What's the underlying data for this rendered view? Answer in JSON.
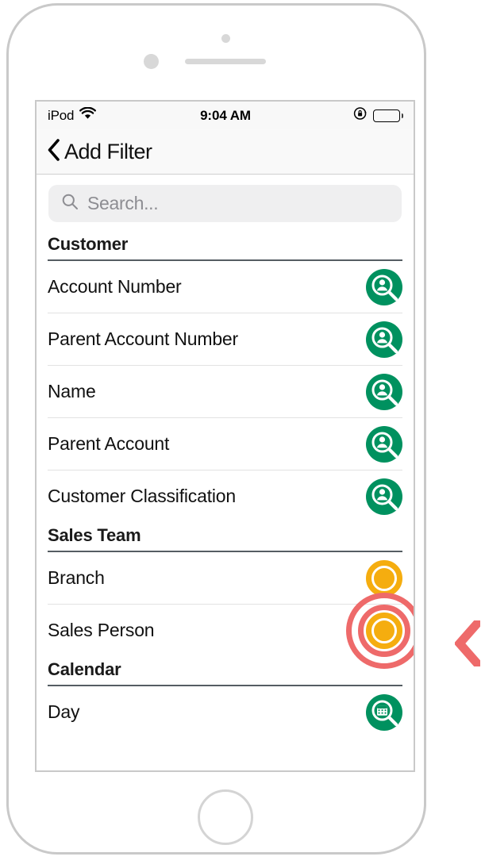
{
  "device": {
    "kind": "iphone-mockup"
  },
  "status_bar": {
    "carrier": "iPod",
    "wifi_icon": "wifi-icon",
    "time": "9:04 AM",
    "rotation_lock_icon": "rotation-lock-icon",
    "battery_icon": "battery-full-icon"
  },
  "nav_bar": {
    "back_icon": "chevron-left-icon",
    "title": "Add Filter"
  },
  "search": {
    "icon": "search-icon",
    "placeholder": "Search...",
    "value": ""
  },
  "list": {
    "sections": [
      {
        "header": "Customer",
        "rows": [
          {
            "label": "Account Number",
            "icon": "person-search-icon",
            "icon_color": "#00915f"
          },
          {
            "label": "Parent Account Number",
            "icon": "person-search-icon",
            "icon_color": "#00915f"
          },
          {
            "label": "Name",
            "icon": "person-search-icon",
            "icon_color": "#00915f"
          },
          {
            "label": "Parent Account",
            "icon": "person-search-icon",
            "icon_color": "#00915f"
          },
          {
            "label": "Customer Classification",
            "icon": "person-search-icon",
            "icon_color": "#00915f"
          }
        ]
      },
      {
        "header": "Sales Team",
        "rows": [
          {
            "label": "Branch",
            "icon": "amber-circle-icon",
            "icon_color": "#f5ad0f"
          },
          {
            "label": "Sales Person",
            "icon": "amber-circle-icon",
            "icon_color": "#f5ad0f",
            "tapped": true
          }
        ]
      },
      {
        "header": "Calendar",
        "rows": [
          {
            "label": "Day",
            "icon": "calendar-search-icon",
            "icon_color": "#00915f"
          }
        ]
      }
    ]
  },
  "annotation": {
    "tap_ripple_color": "#ee6a6a",
    "edge_chevron_icon": "chevron-left-icon",
    "edge_chevron_color": "#ee6a6a"
  },
  "colors": {
    "green": "#00915f",
    "amber": "#f5ad0f",
    "salmon": "#ee6a6a",
    "nav_background": "#f9f9f9",
    "search_background": "#efeff0"
  }
}
